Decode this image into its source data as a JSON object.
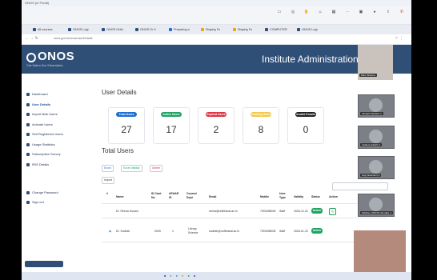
{
  "window": {
    "title": "ONOS (in Portal)"
  },
  "browser": {
    "tabs": [
      "All courses",
      "ONOS Logi",
      "ONOS Onlin",
      "ONOS Dr X",
      "Preparing a",
      "Staying Fo",
      "Staying Fo",
      "COMPUTER",
      "ONOS Logi"
    ],
    "url": "onos.gov.in/onos/userDetails"
  },
  "header": {
    "logo": "ONOS",
    "logo_sub": "One Nation One Subscription",
    "panel_title": "Institute Administration Panel"
  },
  "sidebar": {
    "items": [
      {
        "label": "Dashboard",
        "active": false
      },
      {
        "label": "User Details",
        "active": true
      },
      {
        "label": "Import Bulk Users",
        "active": false
      },
      {
        "label": "Activate Users",
        "active": false
      },
      {
        "label": "Self Registered Users",
        "active": false
      },
      {
        "label": "Usage Statistics",
        "active": false
      },
      {
        "label": "Subscription Survey",
        "active": false
      },
      {
        "label": "IRIS Details",
        "active": false
      },
      {
        "label": "Change Password",
        "active": false
      },
      {
        "label": "Sign out",
        "active": false
      }
    ]
  },
  "main": {
    "details_title": "User Details",
    "cards": [
      {
        "label": "Total Users",
        "value": "27",
        "color": "#1f6fd1"
      },
      {
        "label": "Active Users",
        "value": "17",
        "color": "#1fa463"
      },
      {
        "label": "Expired Users",
        "value": "2",
        "color": "#dc3545"
      },
      {
        "label": "Pending Users",
        "value": "8",
        "color": "#f2c94c"
      },
      {
        "label": "Invalid Emails",
        "value": "0",
        "color": "#222222"
      }
    ],
    "users_title": "Total Users",
    "buttons": [
      "Excel",
      "Excel Validity",
      "Delete"
    ],
    "import_label": "Import",
    "add_label": "Add New User",
    "search_label": "Search:"
  },
  "table": {
    "headers": [
      "#",
      "Name",
      "ID Card No",
      "APAAR ID",
      "Course/ Dept",
      "Email",
      "Mobile",
      "User Type",
      "Validity",
      "Status",
      "Action"
    ],
    "rows": [
      {
        "name": "Dr. Reena Sonam",
        "id": "",
        "apaar": "",
        "course": "",
        "email": "reena@onfbharat.ac.in",
        "mobile": "7903498049",
        "type": "Staff",
        "validity": "2026-12-31",
        "status": "Active"
      },
      {
        "name": "Dr. Sudesh",
        "id": "0009",
        "apaar": "1",
        "course": "Library Science",
        "email": "sudesh@onfbharat.ac.in",
        "mobile": "7903498032",
        "type": "Staff",
        "validity": "2026-01-31",
        "status": "Active"
      }
    ]
  },
  "participants": [
    {
      "name": "Main Sharma"
    },
    {
      "name": "Infopark Student 4"
    },
    {
      "name": "Institute (Dash) 3"
    },
    {
      "name": "Gigi (Sanchez) 3"
    },
    {
      "name": "Siddheo (ONOS) Sundar) 4"
    }
  ],
  "colors": {
    "header": "#2f4f77",
    "accent": "#1f6fd1",
    "active": "#1fa463"
  }
}
